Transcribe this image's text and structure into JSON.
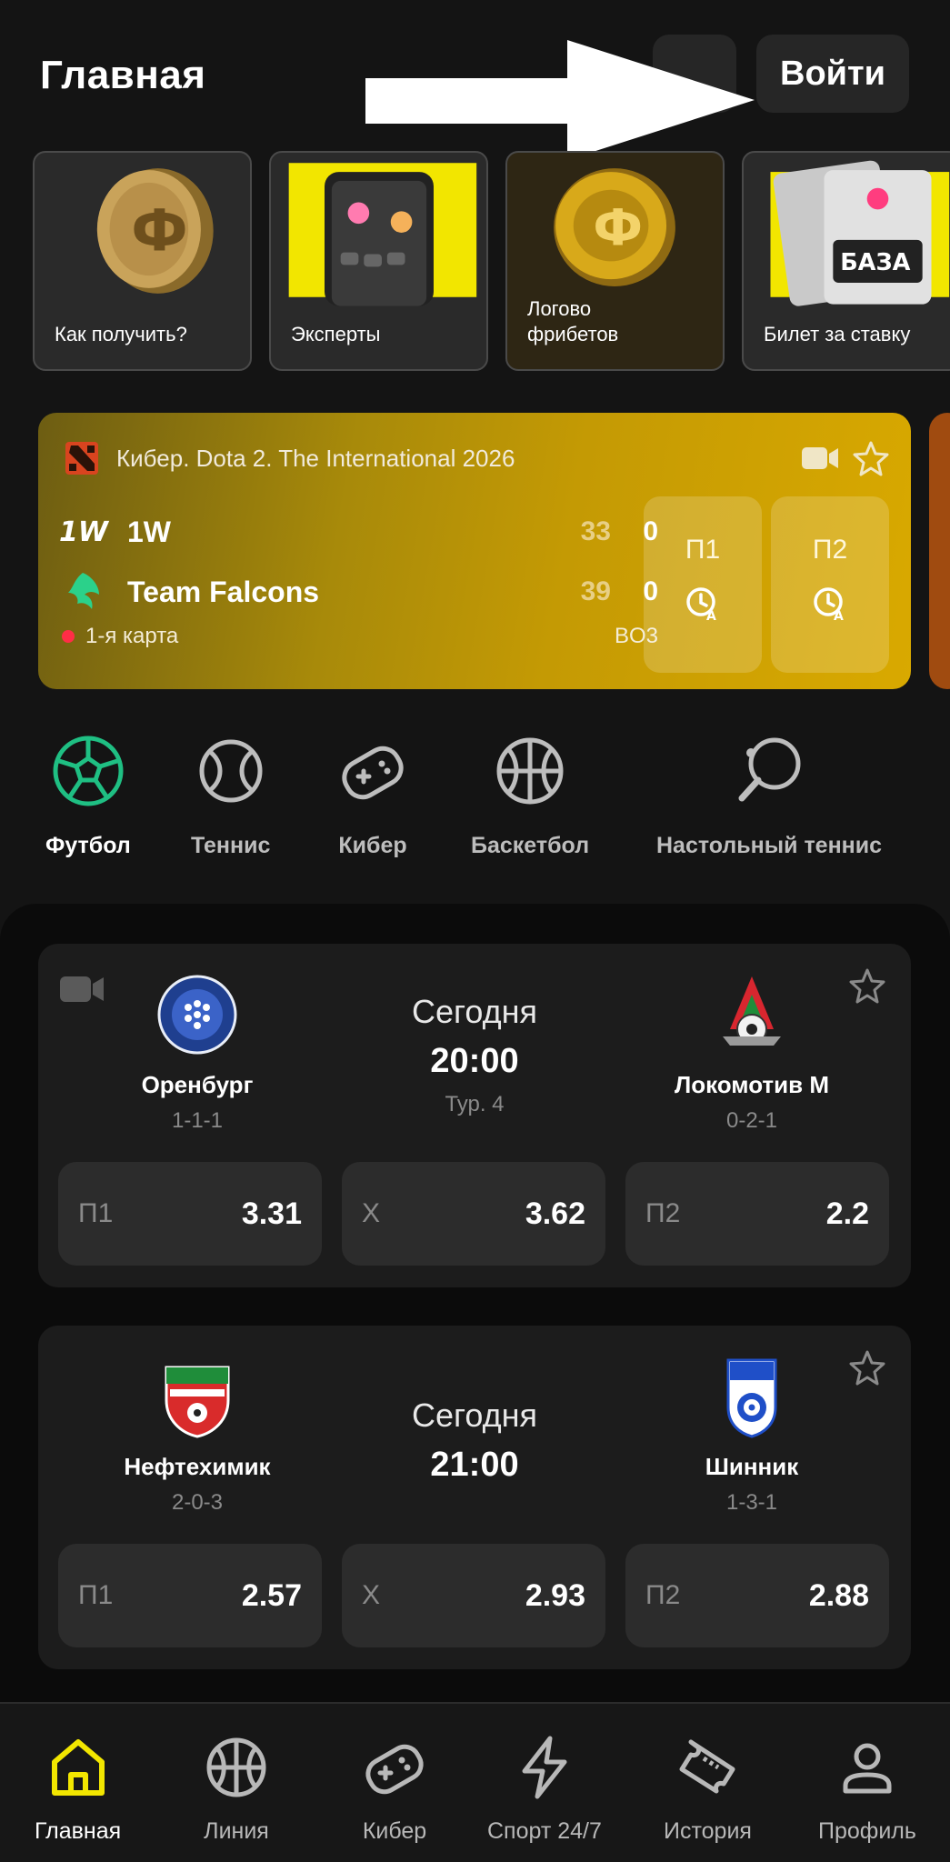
{
  "header": {
    "title": "Главная",
    "login_label": "Войти"
  },
  "stories": [
    {
      "label_line1": "Как получить?",
      "label_line2": ""
    },
    {
      "label_line1": "Эксперты",
      "label_line2": ""
    },
    {
      "label_line1": "Логово",
      "label_line2": "фрибетов"
    },
    {
      "label_line1": "Билет за ставку",
      "label_line2": ""
    }
  ],
  "live_match": {
    "tournament": "Кибер. Dota 2. The International 2026",
    "team1": {
      "name": "1W",
      "logo_text": "1W",
      "score": "33",
      "maps": "0"
    },
    "team2": {
      "name": "Team Falcons",
      "score": "39",
      "maps": "0"
    },
    "map": "1-я карта",
    "format": "BO3",
    "odd1_label": "П1",
    "odd2_label": "П2",
    "colors": {
      "card_start": "#6d5d12",
      "card_end": "#d9a900",
      "live_dot": "#ff2d46"
    }
  },
  "sports": [
    {
      "label": "Футбол",
      "icon": "football-icon",
      "active": true
    },
    {
      "label": "Теннис",
      "icon": "tennis-icon",
      "active": false
    },
    {
      "label": "Кибер",
      "icon": "gamepad-icon",
      "active": false
    },
    {
      "label": "Баскетбол",
      "icon": "basketball-icon",
      "active": false
    },
    {
      "label": "Настольный теннис",
      "icon": "table-tennis-icon",
      "active": false
    }
  ],
  "events": [
    {
      "home": {
        "name": "Оренбург",
        "form": "1-1-1"
      },
      "away": {
        "name": "Локомотив М",
        "form": "0-2-1"
      },
      "day": "Сегодня",
      "time": "20:00",
      "round": "Тур. 4",
      "odds": [
        {
          "label": "П1",
          "value": "3.31"
        },
        {
          "label": "X",
          "value": "3.62"
        },
        {
          "label": "П2",
          "value": "2.2"
        }
      ]
    },
    {
      "home": {
        "name": "Нефтехимик",
        "form": "2-0-3"
      },
      "away": {
        "name": "Шинник",
        "form": "1-3-1"
      },
      "day": "Сегодня",
      "time": "21:00",
      "round": "",
      "odds": [
        {
          "label": "П1",
          "value": "2.57"
        },
        {
          "label": "X",
          "value": "2.93"
        },
        {
          "label": "П2",
          "value": "2.88"
        }
      ]
    }
  ],
  "nav": [
    {
      "label": "Главная",
      "icon": "home-icon",
      "active": true
    },
    {
      "label": "Линия",
      "icon": "basketball-icon",
      "active": false
    },
    {
      "label": "Кибер",
      "icon": "gamepad-icon",
      "active": false
    },
    {
      "label": "Спорт 24/7",
      "icon": "lightning-icon",
      "active": false
    },
    {
      "label": "История",
      "icon": "ticket-icon",
      "active": false
    },
    {
      "label": "Профиль",
      "icon": "user-icon",
      "active": false
    }
  ],
  "colors": {
    "accent_green": "#1fbf83",
    "accent_yellow": "#f2e600",
    "background": "#141414"
  }
}
